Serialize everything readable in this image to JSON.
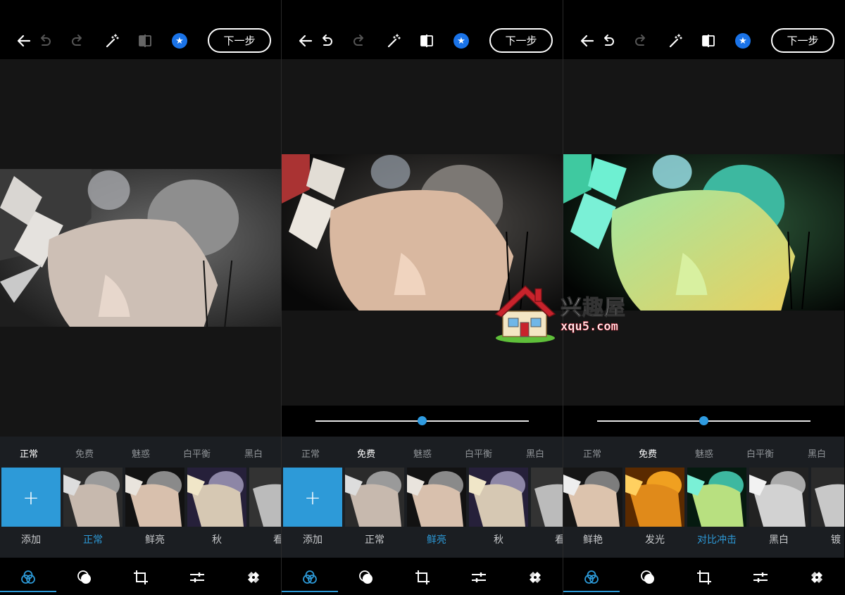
{
  "colors": {
    "accent": "#2d9ad8",
    "star_blue": "#1a73e8",
    "canvas_bg": "#151515",
    "filter_bg": "#1b1e22"
  },
  "panels": [
    {
      "toolbar": {
        "next_label": "下一步",
        "icons": [
          "back-arrow-icon",
          "undo-icon",
          "redo-icon",
          "magic-wand-icon",
          "compare-icon",
          "star-icon"
        ]
      },
      "categories": [
        {
          "label": "正常",
          "active": true
        },
        {
          "label": "免费",
          "active": false
        },
        {
          "label": "魅惑",
          "active": false
        },
        {
          "label": "白平衡",
          "active": false
        },
        {
          "label": "黑白",
          "active": false
        }
      ],
      "filters": [
        {
          "label": "添加",
          "kind": "add",
          "add_symbol": "+"
        },
        {
          "label": "正常",
          "kind": "normal",
          "selected": true
        },
        {
          "label": "鲜亮",
          "kind": "vivid"
        },
        {
          "label": "秋",
          "kind": "autumn"
        },
        {
          "label": "看",
          "kind": "partial"
        }
      ]
    },
    {
      "toolbar": {
        "next_label": "下一步",
        "icons": [
          "back-arrow-icon",
          "undo-icon",
          "redo-icon",
          "magic-wand-icon",
          "compare-icon",
          "star-icon"
        ]
      },
      "slider": {
        "value": 0.5
      },
      "categories": [
        {
          "label": "正常",
          "active": false
        },
        {
          "label": "免费",
          "active": true
        },
        {
          "label": "魅惑",
          "active": false
        },
        {
          "label": "白平衡",
          "active": false
        },
        {
          "label": "黑白",
          "active": false
        }
      ],
      "filters": [
        {
          "label": "添加",
          "kind": "add",
          "add_symbol": "+"
        },
        {
          "label": "正常",
          "kind": "normal"
        },
        {
          "label": "鲜亮",
          "kind": "vivid",
          "selected": true
        },
        {
          "label": "秋",
          "kind": "autumn"
        },
        {
          "label": "看",
          "kind": "partial"
        }
      ]
    },
    {
      "toolbar": {
        "next_label": "下一步",
        "icons": [
          "back-arrow-icon",
          "undo-icon",
          "redo-icon",
          "magic-wand-icon",
          "compare-icon",
          "star-icon"
        ]
      },
      "slider": {
        "value": 0.5
      },
      "categories": [
        {
          "label": "正常",
          "active": false
        },
        {
          "label": "免费",
          "active": true
        },
        {
          "label": "魅惑",
          "active": false
        },
        {
          "label": "白平衡",
          "active": false
        },
        {
          "label": "黑白",
          "active": false
        }
      ],
      "filters": [
        {
          "label": "鲜艳",
          "kind": "vivid"
        },
        {
          "label": "发光",
          "kind": "glow"
        },
        {
          "label": "对比冲击",
          "kind": "contrast",
          "selected": true
        },
        {
          "label": "黑白",
          "kind": "bw"
        },
        {
          "label": "镀",
          "kind": "partial"
        }
      ]
    }
  ],
  "bottom_nav": [
    "filters-icon",
    "overlay-icon",
    "crop-icon",
    "adjust-icon",
    "heal-icon"
  ],
  "watermark": {
    "title": "兴趣屋",
    "url": "xqu5.com"
  }
}
